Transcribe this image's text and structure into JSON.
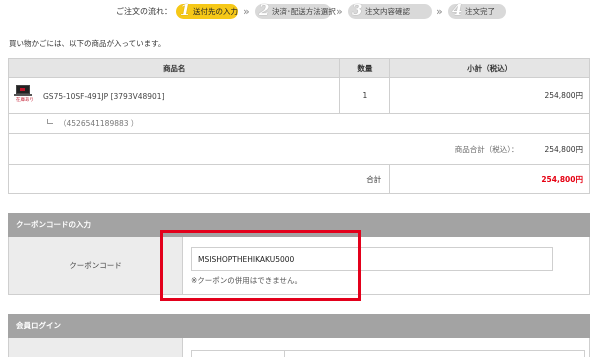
{
  "steps": {
    "label": "ご注文の流れ：",
    "items": [
      {
        "num": "1",
        "label": "送付先の入力"
      },
      {
        "num": "2",
        "label": "決済･配送方法選択"
      },
      {
        "num": "3",
        "label": "注文内容確認"
      },
      {
        "num": "4",
        "label": "注文完了"
      }
    ],
    "separator": "»"
  },
  "intro": "買い物かごには、以下の商品が入っています。",
  "cart": {
    "headers": {
      "name": "商品名",
      "qty": "数量",
      "subtotal": "小計（税込）"
    },
    "item": {
      "name": "GS75-10SF-491JP [3793V48901]",
      "thumb_tag": "在庫あり",
      "qty": "1",
      "subtotal": "254,800円",
      "jan": "（4526541189883 ）"
    },
    "goods_total_label": "商品合計（税込）：",
    "goods_total": "254,800円",
    "total_label": "合計",
    "total": "254,800円"
  },
  "coupon": {
    "title": "クーポンコードの入力",
    "label": "クーポンコード",
    "value": "MSISHOPTHEHIKAKU5000",
    "note": "※クーポンの併用はできません。"
  },
  "login": {
    "title": "会員ログイン"
  },
  "colors": {
    "accent_step": "#f6c817",
    "total_red": "#e60012",
    "highlight_red": "#e3001b",
    "section_gray": "#a3a3a3"
  }
}
